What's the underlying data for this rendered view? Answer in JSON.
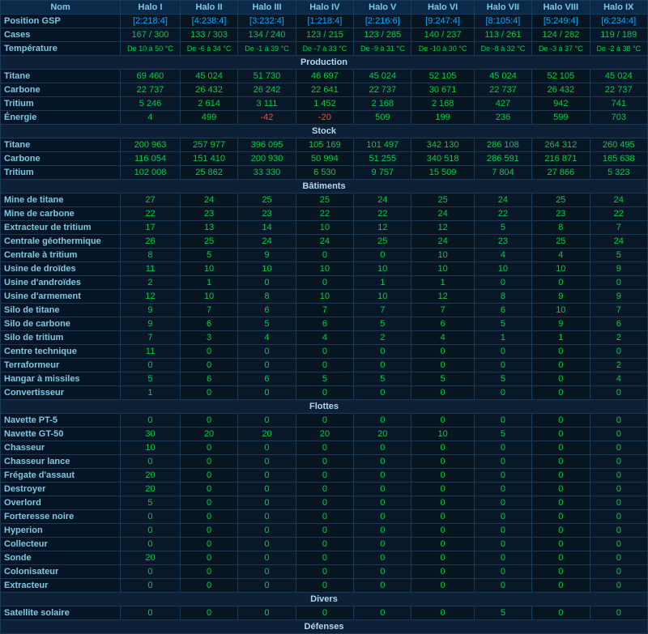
{
  "headers": {
    "nom": "Nom",
    "halos": [
      "Halo I",
      "Halo II",
      "Halo III",
      "Halo IV",
      "Halo V",
      "Halo VI",
      "Halo VII",
      "Halo VIII",
      "Halo IX"
    ]
  },
  "rows": {
    "position_gsp": {
      "label": "Position GSP",
      "values": [
        "[2:218:4]",
        "[4:238:4]",
        "[3:232:4]",
        "[1:218:4]",
        "[2:216:6]",
        "[9:247:4]",
        "[8:105:4]",
        "[5:249:4]",
        "[6:234:4]"
      ]
    },
    "cases": {
      "label": "Cases",
      "values": [
        "167 / 300",
        "133 / 303",
        "134 / 240",
        "123 / 215",
        "123 / 285",
        "140 / 237",
        "113 / 261",
        "124 / 282",
        "119 / 189"
      ]
    },
    "temperature": {
      "label": "Température",
      "values": [
        "De 10 à 50 °C",
        "De -6 à 34 °C",
        "De -1 à 39 °C",
        "De -7 à 33 °C",
        "De -9 à 31 °C",
        "De -10 à 30 °C",
        "De -8 à 32 °C",
        "De -3 à 37 °C",
        "De -2 à 38 °C"
      ]
    }
  },
  "sections": {
    "production": {
      "title": "Production",
      "rows": [
        {
          "label": "Titane",
          "values": [
            "69 460",
            "45 024",
            "51 730",
            "46 697",
            "45 024",
            "52 105",
            "45 024",
            "52 105",
            "45 024"
          ]
        },
        {
          "label": "Carbone",
          "values": [
            "22 737",
            "26 432",
            "26 242",
            "22 641",
            "22 737",
            "30 671",
            "22 737",
            "26 432",
            "22 737"
          ]
        },
        {
          "label": "Tritium",
          "values": [
            "5 246",
            "2 614",
            "3 111",
            "1 452",
            "2 168",
            "2 168",
            "427",
            "942",
            "741"
          ]
        },
        {
          "label": "Énergie",
          "values": [
            "4",
            "499",
            "-42",
            "-20",
            "509",
            "199",
            "236",
            "599",
            "703"
          ],
          "special": [
            false,
            false,
            true,
            true,
            false,
            false,
            false,
            false,
            false
          ]
        }
      ]
    },
    "stock": {
      "title": "Stock",
      "rows": [
        {
          "label": "Titane",
          "values": [
            "200 963",
            "257 977",
            "396 095",
            "105 169",
            "101 497",
            "342 130",
            "286 108",
            "264 312",
            "260 495"
          ]
        },
        {
          "label": "Carbone",
          "values": [
            "116 054",
            "151 410",
            "200 930",
            "50 994",
            "51 255",
            "340 518",
            "286 591",
            "216 871",
            "165 638"
          ]
        },
        {
          "label": "Tritium",
          "values": [
            "102 008",
            "25 862",
            "33 330",
            "6 530",
            "9 757",
            "15 509",
            "7 804",
            "27 866",
            "5 323"
          ]
        }
      ]
    },
    "batiments": {
      "title": "Bâtiments",
      "rows": [
        {
          "label": "Mine de titane",
          "values": [
            "27",
            "24",
            "25",
            "25",
            "24",
            "25",
            "24",
            "25",
            "24"
          ]
        },
        {
          "label": "Mine de carbone",
          "values": [
            "22",
            "23",
            "23",
            "22",
            "22",
            "24",
            "22",
            "23",
            "22"
          ]
        },
        {
          "label": "Extracteur de tritium",
          "values": [
            "17",
            "13",
            "14",
            "10",
            "12",
            "12",
            "5",
            "8",
            "7"
          ]
        },
        {
          "label": "Centrale géothermique",
          "values": [
            "26",
            "25",
            "24",
            "24",
            "25",
            "24",
            "23",
            "25",
            "24"
          ]
        },
        {
          "label": "Centrale à tritium",
          "values": [
            "8",
            "5",
            "9",
            "0",
            "0",
            "10",
            "4",
            "4",
            "5"
          ]
        },
        {
          "label": "Usine de droïdes",
          "values": [
            "11",
            "10",
            "10",
            "10",
            "10",
            "10",
            "10",
            "10",
            "9"
          ]
        },
        {
          "label": "Usine d'androïdes",
          "values": [
            "2",
            "1",
            "0",
            "0",
            "1",
            "1",
            "0",
            "0",
            "0"
          ]
        },
        {
          "label": "Usine d'armement",
          "values": [
            "12",
            "10",
            "8",
            "10",
            "10",
            "12",
            "8",
            "9",
            "9"
          ]
        },
        {
          "label": "Silo de titane",
          "values": [
            "9",
            "7",
            "6",
            "7",
            "7",
            "7",
            "6",
            "10",
            "7"
          ]
        },
        {
          "label": "Silo de carbone",
          "values": [
            "9",
            "6",
            "5",
            "6",
            "5",
            "6",
            "5",
            "9",
            "6"
          ]
        },
        {
          "label": "Silo de tritium",
          "values": [
            "7",
            "3",
            "4",
            "4",
            "2",
            "4",
            "1",
            "1",
            "2"
          ]
        },
        {
          "label": "Centre technique",
          "values": [
            "11",
            "0",
            "0",
            "0",
            "0",
            "0",
            "0",
            "0",
            "0"
          ]
        },
        {
          "label": "Terraformeur",
          "values": [
            "0",
            "0",
            "0",
            "0",
            "0",
            "0",
            "0",
            "0",
            "2"
          ]
        },
        {
          "label": "Hangar à missiles",
          "values": [
            "5",
            "6",
            "6",
            "5",
            "5",
            "5",
            "5",
            "0",
            "4"
          ]
        },
        {
          "label": "Convertisseur",
          "values": [
            "1",
            "0",
            "0",
            "0",
            "0",
            "0",
            "0",
            "0",
            "0"
          ]
        }
      ]
    },
    "flottes": {
      "title": "Flottes",
      "rows": [
        {
          "label": "Navette PT-5",
          "values": [
            "0",
            "0",
            "0",
            "0",
            "0",
            "0",
            "0",
            "0",
            "0"
          ]
        },
        {
          "label": "Navette GT-50",
          "values": [
            "30",
            "20",
            "20",
            "20",
            "20",
            "10",
            "5",
            "0",
            "0"
          ]
        },
        {
          "label": "Chasseur",
          "values": [
            "10",
            "0",
            "0",
            "0",
            "0",
            "0",
            "0",
            "0",
            "0"
          ]
        },
        {
          "label": "Chasseur lance",
          "values": [
            "0",
            "0",
            "0",
            "0",
            "0",
            "0",
            "0",
            "0",
            "0"
          ]
        },
        {
          "label": "Frégate d'assaut",
          "values": [
            "20",
            "0",
            "0",
            "0",
            "0",
            "0",
            "0",
            "0",
            "0"
          ]
        },
        {
          "label": "Destroyer",
          "values": [
            "20",
            "0",
            "0",
            "0",
            "0",
            "0",
            "0",
            "0",
            "0"
          ]
        },
        {
          "label": "Overlord",
          "values": [
            "5",
            "0",
            "0",
            "0",
            "0",
            "0",
            "0",
            "0",
            "0"
          ]
        },
        {
          "label": "Forteresse noire",
          "values": [
            "0",
            "0",
            "0",
            "0",
            "0",
            "0",
            "0",
            "0",
            "0"
          ]
        },
        {
          "label": "Hyperion",
          "values": [
            "0",
            "0",
            "0",
            "0",
            "0",
            "0",
            "0",
            "0",
            "0"
          ]
        },
        {
          "label": "Collecteur",
          "values": [
            "0",
            "0",
            "0",
            "0",
            "0",
            "0",
            "0",
            "0",
            "0"
          ]
        },
        {
          "label": "Sonde",
          "values": [
            "20",
            "0",
            "0",
            "0",
            "0",
            "0",
            "0",
            "0",
            "0"
          ]
        },
        {
          "label": "Colonisateur",
          "values": [
            "0",
            "0",
            "0",
            "0",
            "0",
            "0",
            "0",
            "0",
            "0"
          ]
        },
        {
          "label": "Extracteur",
          "values": [
            "0",
            "0",
            "0",
            "0",
            "0",
            "0",
            "0",
            "0",
            "0"
          ]
        }
      ]
    },
    "divers": {
      "title": "Divers",
      "rows": [
        {
          "label": "Satellite solaire",
          "values": [
            "0",
            "0",
            "0",
            "0",
            "0",
            "0",
            "5",
            "0",
            "0"
          ]
        }
      ]
    },
    "defenses": {
      "title": "Défenses"
    }
  }
}
